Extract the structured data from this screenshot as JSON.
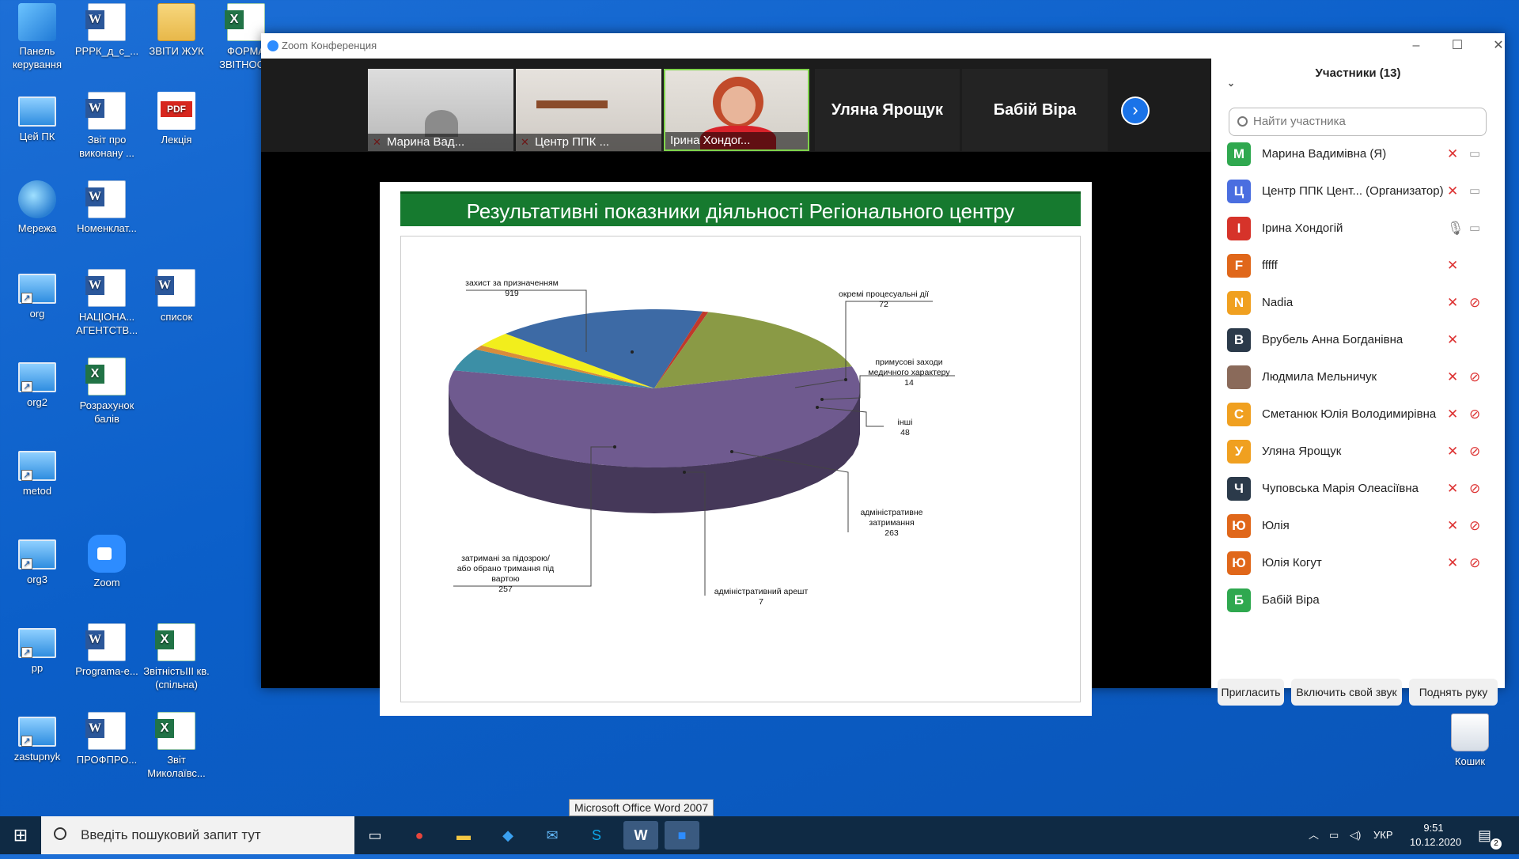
{
  "desktop": {
    "icons": [
      {
        "label": "Панель керування",
        "icon": "control-panel-icon"
      },
      {
        "label": "РРРК_д_с_...",
        "icon": "word-doc-icon"
      },
      {
        "label": "ЗВІТИ ЖУК",
        "icon": "folder-icon"
      },
      {
        "label": "ФОРМА ЗВІТНОС...",
        "icon": "excel-doc-icon"
      },
      {
        "label": "Цей ПК",
        "icon": "this-pc-icon"
      },
      {
        "label": "Звіт про виконану ...",
        "icon": "word-doc-icon"
      },
      {
        "label": "Лекція",
        "icon": "pdf-icon"
      },
      {
        "label": "Мережа",
        "icon": "network-icon"
      },
      {
        "label": "Номенклат...",
        "icon": "word-doc-icon"
      },
      {
        "label": "org",
        "icon": "pc-shortcut-icon"
      },
      {
        "label": "НАЦІОНА... АГЕНТСТВ...",
        "icon": "word-doc-icon"
      },
      {
        "label": "список",
        "icon": "word-doc-icon"
      },
      {
        "label": "org2",
        "icon": "pc-shortcut-icon"
      },
      {
        "label": "Розрахунок балів",
        "icon": "excel-doc-icon"
      },
      {
        "label": "metod",
        "icon": "pc-shortcut-icon"
      },
      {
        "label": "org3",
        "icon": "pc-shortcut-icon"
      },
      {
        "label": "Zoom",
        "icon": "zoom-app-icon"
      },
      {
        "label": "pp",
        "icon": "pc-shortcut-icon"
      },
      {
        "label": "Programa-e...",
        "icon": "word-doc-icon"
      },
      {
        "label": "ЗвітністьIII кв. (спільна)",
        "icon": "excel-doc-icon"
      },
      {
        "label": "zastupnyk",
        "icon": "pc-shortcut-icon"
      },
      {
        "label": "ПРОФПРО...",
        "icon": "word-doc-icon"
      },
      {
        "label": "Звіт Миколаївс...",
        "icon": "excel-doc-icon"
      }
    ],
    "recycle_bin": "Кошик"
  },
  "zoom": {
    "window_title": "Zoom Конференция",
    "thumbnails": [
      {
        "name": "Марина Вад..."
      },
      {
        "name": "Центр ППК ..."
      },
      {
        "name": "Ірина Хондог..."
      }
    ],
    "name_tiles": [
      "Уляна Ярощук",
      "Бабій Віра"
    ],
    "slide": {
      "title": "Результативні показники діяльності Регіонального центру"
    }
  },
  "chart_data": {
    "type": "pie",
    "title": "Результативні показники діяльності Регіонального центру",
    "slices": [
      {
        "label": "захист за призначенням",
        "value": 919,
        "color": "#6f5a8f"
      },
      {
        "label": "окремі процесуальні дії",
        "value": 72,
        "color": "#3c8fa6"
      },
      {
        "label": "примусові заходи медичного характеру",
        "value": 14,
        "color": "#d98c3a"
      },
      {
        "label": "інші",
        "value": 48,
        "color": "#f2ee1c"
      },
      {
        "label": "адміністративне затримання",
        "value": 263,
        "color": "#3d6aa5"
      },
      {
        "label": "адміністративний арешт",
        "value": 7,
        "color": "#c0392b"
      },
      {
        "label": "затримані за підозрою/ або обрано тримання під вартою",
        "value": 257,
        "color": "#8a9a45"
      }
    ]
  },
  "participants": {
    "header": "Участники (13)",
    "search_placeholder": "Найти участника",
    "list": [
      {
        "initial": "M",
        "color": "#2fa84f",
        "name": "Марина Вадимівна (Я)",
        "mic": "muted",
        "video": true
      },
      {
        "initial": "Ц",
        "color": "#4a6ee0",
        "name": "Центр ППК Цент...  (Организатор)",
        "mic": "muted",
        "video": true
      },
      {
        "initial": "І",
        "color": "#d6332a",
        "name": "Ірина Хондогій",
        "mic": "on",
        "video": true
      },
      {
        "initial": "F",
        "color": "#e0671a",
        "name": "fffff",
        "mic": "muted",
        "video": false
      },
      {
        "initial": "N",
        "color": "#f0a020",
        "name": "Nadia",
        "mic": "muted",
        "video": "off"
      },
      {
        "initial": "В",
        "color": "#2b3a4a",
        "name": "Врубель Анна Богданівна",
        "mic": "muted",
        "video": false
      },
      {
        "initial": "",
        "color": "#8a6a5a",
        "name": "Людмила Мельничук",
        "mic": "muted",
        "video": "off"
      },
      {
        "initial": "С",
        "color": "#f0a020",
        "name": "Сметанюк Юлія Володимирівна",
        "mic": "muted",
        "video": "off"
      },
      {
        "initial": "У",
        "color": "#f0a020",
        "name": "Уляна Ярощук",
        "mic": "muted",
        "video": "off"
      },
      {
        "initial": "Ч",
        "color": "#2b3a4a",
        "name": "Чуповська Марія Олеасіївна",
        "mic": "muted",
        "video": "off"
      },
      {
        "initial": "Ю",
        "color": "#e0671a",
        "name": "Юлія",
        "mic": "muted",
        "video": "off"
      },
      {
        "initial": "Ю",
        "color": "#e0671a",
        "name": "Юлія Когут",
        "mic": "muted",
        "video": "off"
      },
      {
        "initial": "Б",
        "color": "#2fa84f",
        "name": "Бабій Віра",
        "mic": "none",
        "video": false
      }
    ],
    "buttons": {
      "invite": "Пригласить",
      "unmute": "Включить свой звук",
      "raise_hand": "Поднять руку"
    }
  },
  "taskbar": {
    "search_placeholder": "Введіть пошуковий запит тут",
    "tooltip": "Microsoft Office Word 2007",
    "language": "УКР",
    "time": "9:51",
    "date": "10.12.2020",
    "notifications": "2"
  }
}
